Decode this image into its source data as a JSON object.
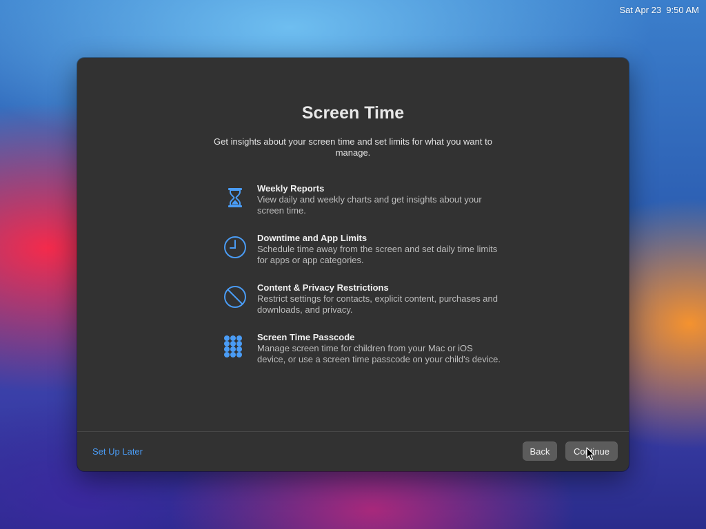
{
  "menubar": {
    "clock": "Sat Apr 23  9:50 AM"
  },
  "window": {
    "title": "Screen Time",
    "subtitle": "Get insights about your screen time and set limits for what you want to manage.",
    "features": [
      {
        "icon": "hourglass-icon",
        "title": "Weekly Reports",
        "description": "View daily and weekly charts and get insights about your screen time."
      },
      {
        "icon": "clock-icon",
        "title": "Downtime and App Limits",
        "description": "Schedule time away from the screen and set daily time limits for apps or app categories."
      },
      {
        "icon": "restriction-icon",
        "title": "Content & Privacy Restrictions",
        "description": "Restrict settings for contacts, explicit content, purchases and downloads, and privacy."
      },
      {
        "icon": "keypad-icon",
        "title": "Screen Time Passcode",
        "description": "Manage screen time for children from your Mac or iOS device, or use a screen time passcode on your child's device."
      }
    ],
    "footer": {
      "setup_later": "Set Up Later",
      "back": "Back",
      "continue": "Continue"
    }
  },
  "colors": {
    "accent": "#4a9cf5",
    "window_bg": "#323232",
    "button_bg": "#5c5c5c"
  }
}
